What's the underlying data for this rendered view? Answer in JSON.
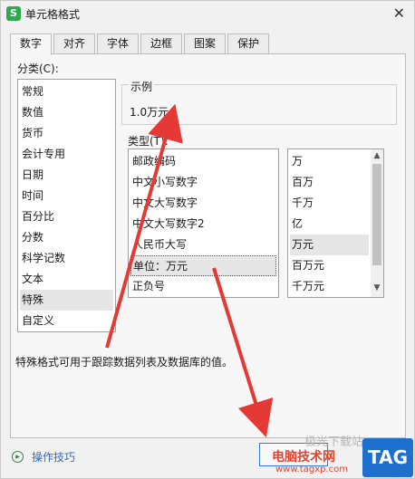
{
  "window": {
    "title": "单元格格式",
    "app_icon_letter": "S",
    "close_glyph": "✕"
  },
  "tabs": [
    {
      "label": "数字",
      "active": true
    },
    {
      "label": "对齐"
    },
    {
      "label": "字体"
    },
    {
      "label": "边框"
    },
    {
      "label": "图案"
    },
    {
      "label": "保护"
    }
  ],
  "category": {
    "label": "分类(C):",
    "items": [
      "常规",
      "数值",
      "货币",
      "会计专用",
      "日期",
      "时间",
      "百分比",
      "分数",
      "科学记数",
      "文本",
      "特殊",
      "自定义"
    ],
    "selected": "特殊"
  },
  "sample": {
    "label": "示例",
    "value": "1.0万元"
  },
  "type": {
    "label": "类型(T):",
    "items": [
      "邮政编码",
      "中文小写数字",
      "中文大写数字",
      "中文大写数字2",
      "人民币大写",
      "单位：万元",
      "正负号"
    ],
    "selected": "单位：万元"
  },
  "unit": {
    "items": [
      "万",
      "百万",
      "千万",
      "亿",
      "万元",
      "百万元",
      "千万元"
    ],
    "selected": "万元",
    "up_arrow": "▲",
    "down_arrow": "▼"
  },
  "description": "特殊格式可用于跟踪数据列表及数据库的值。",
  "footer": {
    "tips_label": "操作技巧",
    "tips_icon_glyph": "▶"
  },
  "watermark": {
    "brand_text": "电脑技术网",
    "url": "www.tagxp.com",
    "tag_text": "TAG",
    "faint_text": "极光下载站"
  },
  "colors": {
    "annotation_arrow": "#e53935",
    "link": "#2d6bc4",
    "selection": "#e6e6e6"
  }
}
